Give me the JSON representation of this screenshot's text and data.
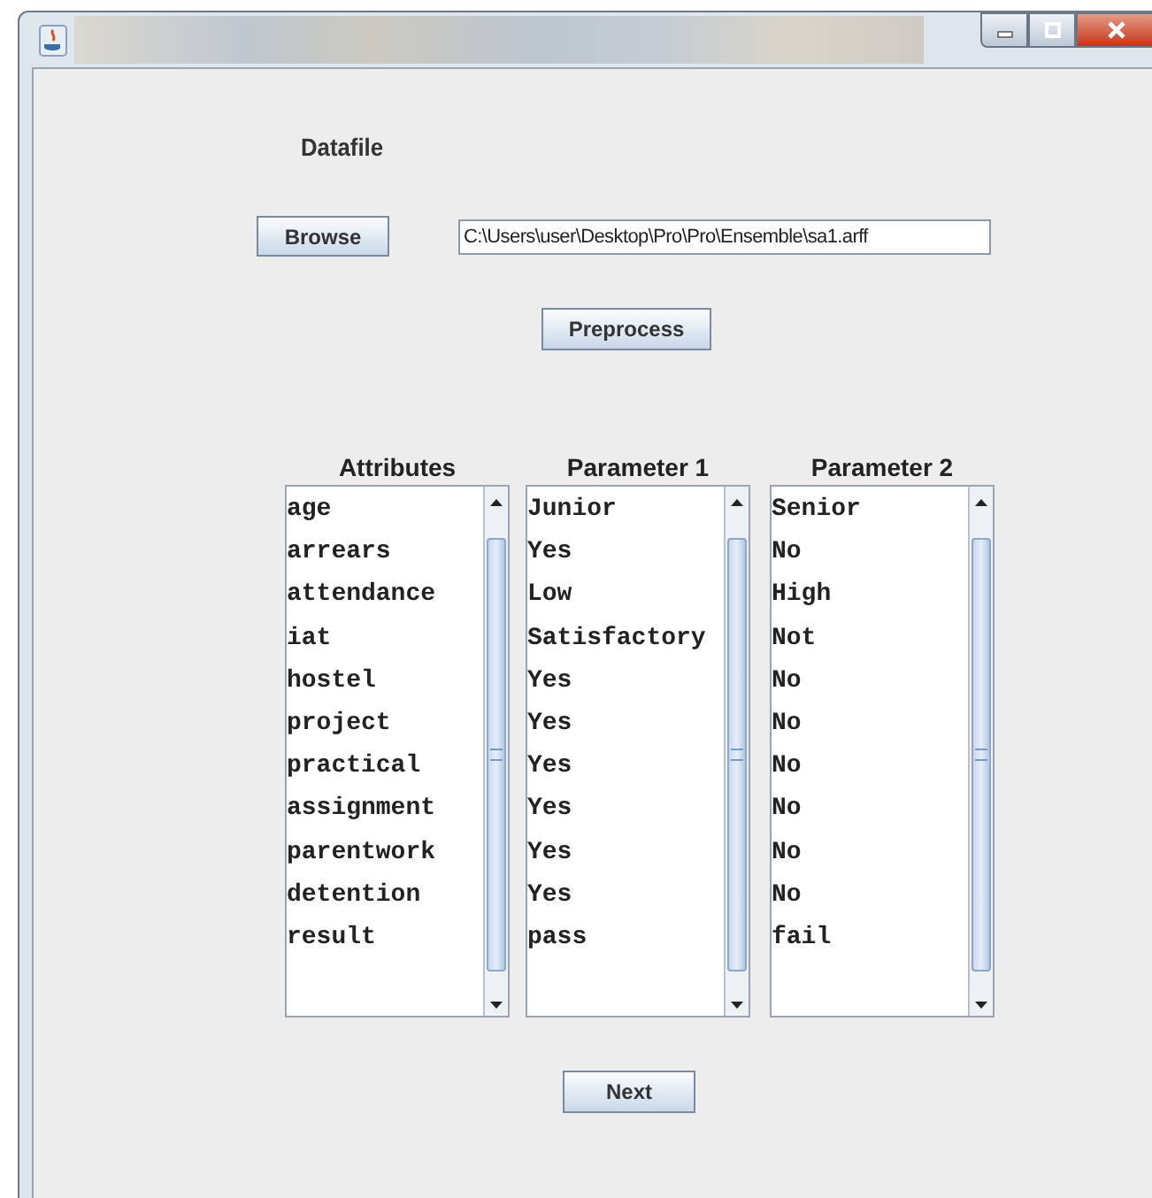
{
  "heading": "Datafile",
  "browse_button": "Browse",
  "path_field": {
    "value": "C:\\Users\\user\\Desktop\\Pro\\Pro\\Ensemble\\sa1.arff"
  },
  "preprocess_button": "Preprocess",
  "lists": [
    {
      "header": "Attributes",
      "items": [
        "age",
        "arrears",
        "attendance",
        "iat",
        "hostel",
        "project",
        "practical",
        "assignment",
        "parentwork",
        "detention",
        "result"
      ]
    },
    {
      "header": "Parameter 1",
      "items": [
        "Junior",
        "Yes",
        "Low",
        "Satisfactory",
        "Yes",
        "Yes",
        "Yes",
        "Yes",
        "Yes",
        "Yes",
        "pass"
      ]
    },
    {
      "header": "Parameter 2",
      "items": [
        "Senior",
        "No",
        "High",
        "Not",
        "No",
        "No",
        "No",
        "No",
        "No",
        "No",
        "fail"
      ]
    }
  ],
  "next_button": "Next"
}
